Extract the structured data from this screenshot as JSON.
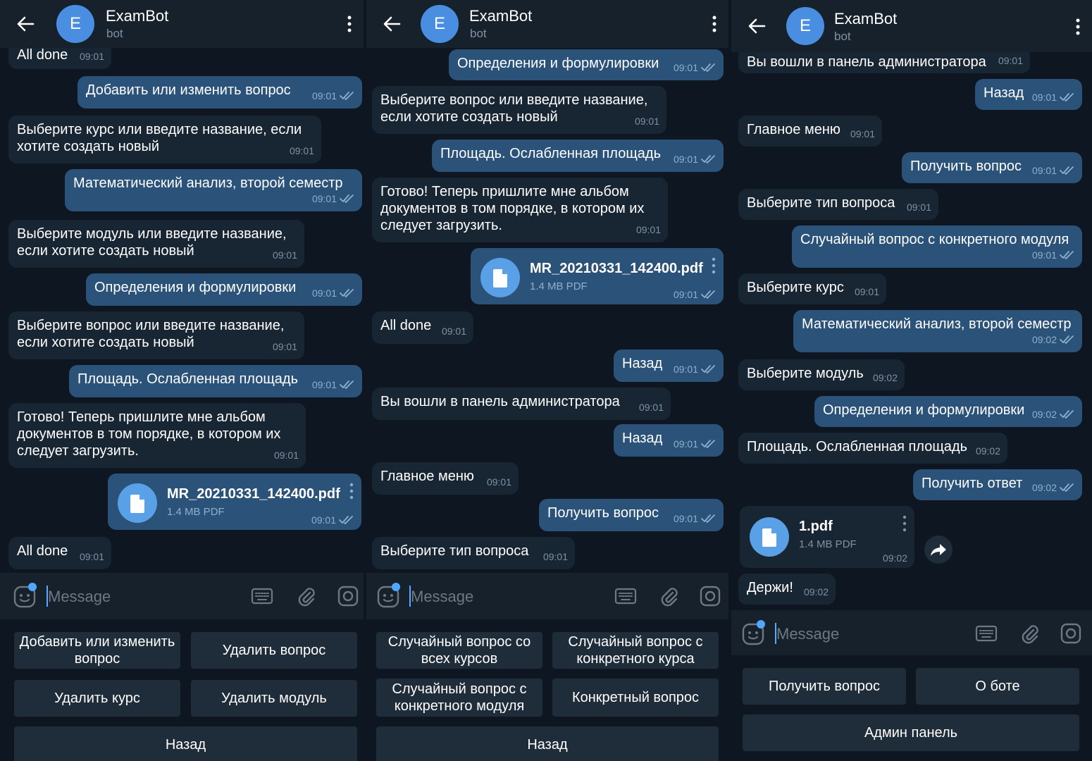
{
  "colors": {
    "background": "#0e1621",
    "header": "#17212b",
    "incoming_bubble": "#182533",
    "outgoing_bubble": "#2b5278",
    "accent": "#4a8ee2",
    "keyboard_button": "#1f2c39"
  },
  "header": {
    "title": "ExamBot",
    "subtitle": "bot",
    "avatar_letter": "E"
  },
  "composer": {
    "placeholder": "Message"
  },
  "panel1": {
    "messages": [
      {
        "dir": "in",
        "text": "All done",
        "time": "09:01"
      },
      {
        "dir": "out",
        "text": "Добавить или изменить вопрос",
        "time": "09:01"
      },
      {
        "dir": "in",
        "text": "Выберите курс или введите название, если хотите создать новый",
        "time": "09:01"
      },
      {
        "dir": "out",
        "text": "Математический анализ, второй семестр",
        "time": "09:01"
      },
      {
        "dir": "in",
        "text": "Выберите модуль или введите название, если хотите создать новый",
        "time": "09:01"
      },
      {
        "dir": "out",
        "text": "Определения и формулировки",
        "time": "09:01"
      },
      {
        "dir": "in",
        "text": "Выберите вопрос или введите название, если хотите создать новый",
        "time": "09:01"
      },
      {
        "dir": "out",
        "text": "Площадь. Ослабленная площадь",
        "time": "09:01"
      },
      {
        "dir": "in",
        "text": "Готово! Теперь пришлите мне альбом документов в том порядке, в котором их следует загрузить.",
        "time": "09:01"
      },
      {
        "dir": "out",
        "file_name": "MR_20210331_142400.pdf",
        "file_size": "1.4 MB PDF",
        "time": "09:01"
      },
      {
        "dir": "in",
        "text": "All done",
        "time": "09:01"
      }
    ],
    "keyboard": [
      "Добавить или изменить вопрос",
      "Удалить вопрос",
      "Удалить курс",
      "Удалить модуль",
      "Назад"
    ]
  },
  "panel2": {
    "messages": [
      {
        "dir": "out",
        "text": "Определения и формулировки",
        "time": "09:01"
      },
      {
        "dir": "in",
        "text": "Выберите вопрос или введите название, если хотите создать новый",
        "time": "09:01"
      },
      {
        "dir": "out",
        "text": "Площадь. Ослабленная площадь",
        "time": "09:01"
      },
      {
        "dir": "in",
        "text": "Готово! Теперь пришлите мне альбом документов в том порядке, в котором их следует загрузить.",
        "time": "09:01"
      },
      {
        "dir": "out",
        "file_name": "MR_20210331_142400.pdf",
        "file_size": "1.4 MB PDF",
        "time": "09:01"
      },
      {
        "dir": "in",
        "text": "All done",
        "time": "09:01"
      },
      {
        "dir": "out",
        "text": "Назад",
        "time": "09:01"
      },
      {
        "dir": "in",
        "text": "Вы вошли в панель администратора",
        "time": "09:01"
      },
      {
        "dir": "out",
        "text": "Назад",
        "time": "09:01"
      },
      {
        "dir": "in",
        "text": "Главное меню",
        "time": "09:01"
      },
      {
        "dir": "out",
        "text": "Получить вопрос",
        "time": "09:01"
      },
      {
        "dir": "in",
        "text": "Выберите тип вопроса",
        "time": "09:01"
      }
    ],
    "keyboard": [
      "Случайный вопрос со всех курсов",
      "Случайный вопрос с конкретного курса",
      "Случайный вопрос с конкретного модуля",
      "Конкретный вопрос",
      "Назад"
    ]
  },
  "panel3": {
    "messages": [
      {
        "dir": "in",
        "text": "Вы вошли в панель администратора",
        "time": "09:01"
      },
      {
        "dir": "out",
        "text": "Назад",
        "time": "09:01"
      },
      {
        "dir": "in",
        "text": "Главное меню",
        "time": "09:01"
      },
      {
        "dir": "out",
        "text": "Получить вопрос",
        "time": "09:01"
      },
      {
        "dir": "in",
        "text": "Выберите тип вопроса",
        "time": "09:01"
      },
      {
        "dir": "out",
        "text": "Случайный вопрос с конкретного модуля",
        "time": "09:01"
      },
      {
        "dir": "in",
        "text": "Выберите курс",
        "time": "09:01"
      },
      {
        "dir": "out",
        "text": "Математический анализ, второй семестр",
        "time": "09:02"
      },
      {
        "dir": "in",
        "text": "Выберите модуль",
        "time": "09:02"
      },
      {
        "dir": "out",
        "text": "Определения и формулировки",
        "time": "09:02"
      },
      {
        "dir": "in",
        "text": "Площадь. Ослабленная площадь",
        "time": "09:02"
      },
      {
        "dir": "out",
        "text": "Получить ответ",
        "time": "09:02"
      },
      {
        "dir": "in",
        "file_name": "1.pdf",
        "file_size": "1.4 MB PDF",
        "time": "09:02"
      },
      {
        "dir": "in",
        "text": "Держи!",
        "time": "09:02"
      }
    ],
    "keyboard": [
      "Получить вопрос",
      "О боте",
      "Админ панель"
    ]
  }
}
